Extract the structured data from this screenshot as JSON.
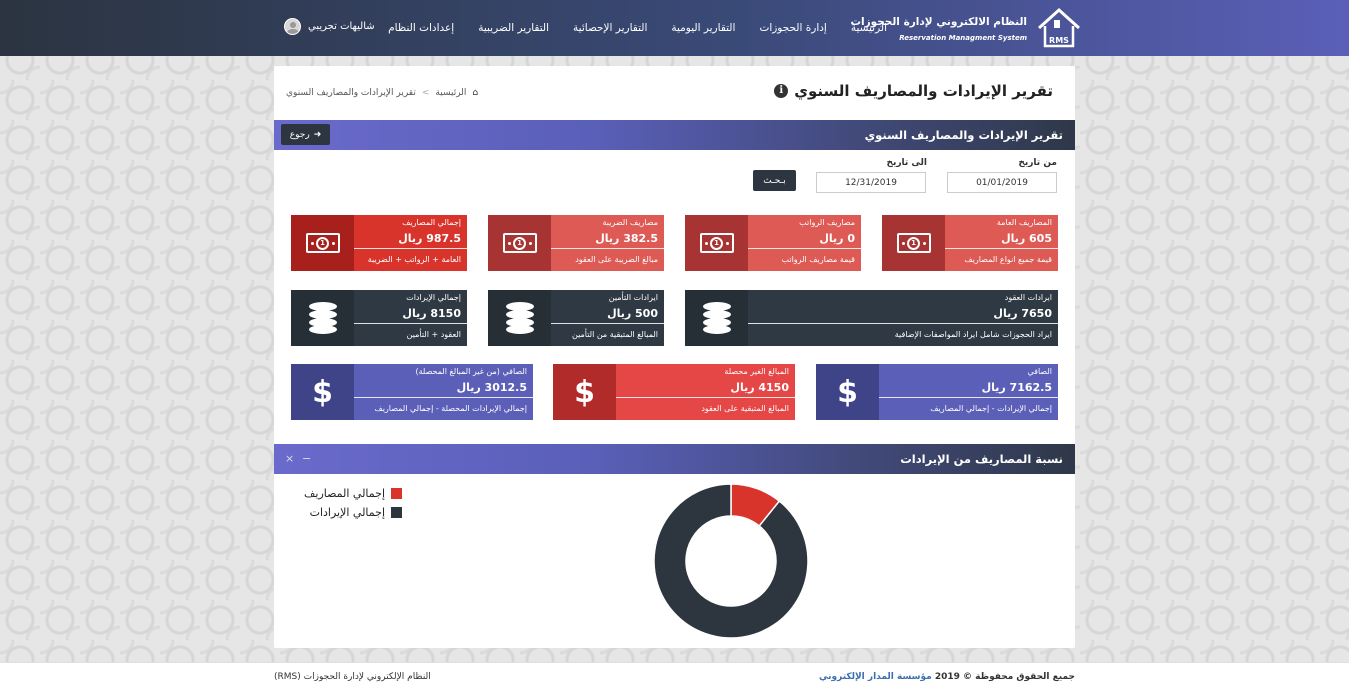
{
  "navbar": {
    "brand_title": "النظام الالكتروني لإدارة الحجوزات",
    "brand_subtitle": "Reservation Managment System",
    "brand_logo_text": "RMS",
    "menu": [
      "الرئيسية",
      "إدارة الحجوزات",
      "التقارير اليومية",
      "التقارير الإحصائية",
      "التقارير الضريبية",
      "إعدادات النظام"
    ],
    "user_name": "شاليهات تجريبي"
  },
  "page": {
    "title": "تقرير الإيرادات والمصاريف السنوي",
    "breadcrumb_home": "الرئيسية",
    "breadcrumb_sep": ">",
    "breadcrumb_current": "تقرير الإيرادات والمصاريف السنوي"
  },
  "report_section": {
    "title": "تقرير الإيرادات والمصاريف السنوي",
    "back_label": "رجوع"
  },
  "filter": {
    "from_label": "من تاريخ",
    "to_label": "الى تاريخ",
    "from_value": "01/01/2019",
    "to_value": "12/31/2019",
    "search_label": "بـحـث"
  },
  "stats_row1": [
    {
      "label": "المصاريف العامة",
      "value": "605  ريال",
      "desc": "قيمة جميع انواع المصاريف"
    },
    {
      "label": "مصاريف الرواتب",
      "value": "0  ريال",
      "desc": "قيمة مصاريف الرواتب"
    },
    {
      "label": "مصاريف الضريبة",
      "value": "382.5  ريال",
      "desc": "مبالغ الضريبة على العقود"
    },
    {
      "label": "إجمالي المصاريف",
      "value": "987.5  ريال",
      "desc": "العامة + الرواتب + الضريبة"
    }
  ],
  "stats_row2": [
    {
      "label": "ايرادات العقود",
      "value": "7650  ريال",
      "desc": "ايراد الحجوزات شامل ايراد المواصفات الإضافية"
    },
    {
      "label": "ايرادات التأمين",
      "value": "500  ريال",
      "desc": "المبالغ المتبقية من التأمين"
    },
    {
      "label": "إجمالي الإيرادات",
      "value": "8150  ريال",
      "desc": "العقود + التأمين"
    }
  ],
  "stats_row3": [
    {
      "label": "الصافي",
      "value": "7162.5  ريال",
      "desc": "إجمالي الإيرادات - إجمالي المصاريف"
    },
    {
      "label": "المبالغ الغير محصلة",
      "value": "4150  ريال",
      "desc": "المبالغ المتبقية على العقود"
    },
    {
      "label": "الصافي (من غير المبالغ المحصلة)",
      "value": "3012.5  ريال",
      "desc": "إجمالي الإيرادات المحصلة - إجمالي المصاريف"
    }
  ],
  "icons": {
    "money": "money-bill-icon",
    "database": "database-icon",
    "dollar": "dollar-icon",
    "coin_glyph": "1",
    "dollar_glyph": "$"
  },
  "chart_section": {
    "title": "نسبة المصاريف من الإيرادات",
    "minimize": "−",
    "close": "×"
  },
  "chart_data": {
    "type": "pie",
    "categories": [
      "إجمالي المصاريف",
      "إجمالي الإيرادات"
    ],
    "values": [
      987.5,
      8150
    ],
    "colors": [
      "#d9342b",
      "#2d363f"
    ],
    "legend_position": "top-left",
    "donut": true
  },
  "footer": {
    "rights": "جميع الحقوق محفوظة © 2019",
    "company": "مؤسسة المدار الإلكتروني",
    "system": "النظام الإلكتروني لإدارة الحجوزات (RMS)"
  }
}
